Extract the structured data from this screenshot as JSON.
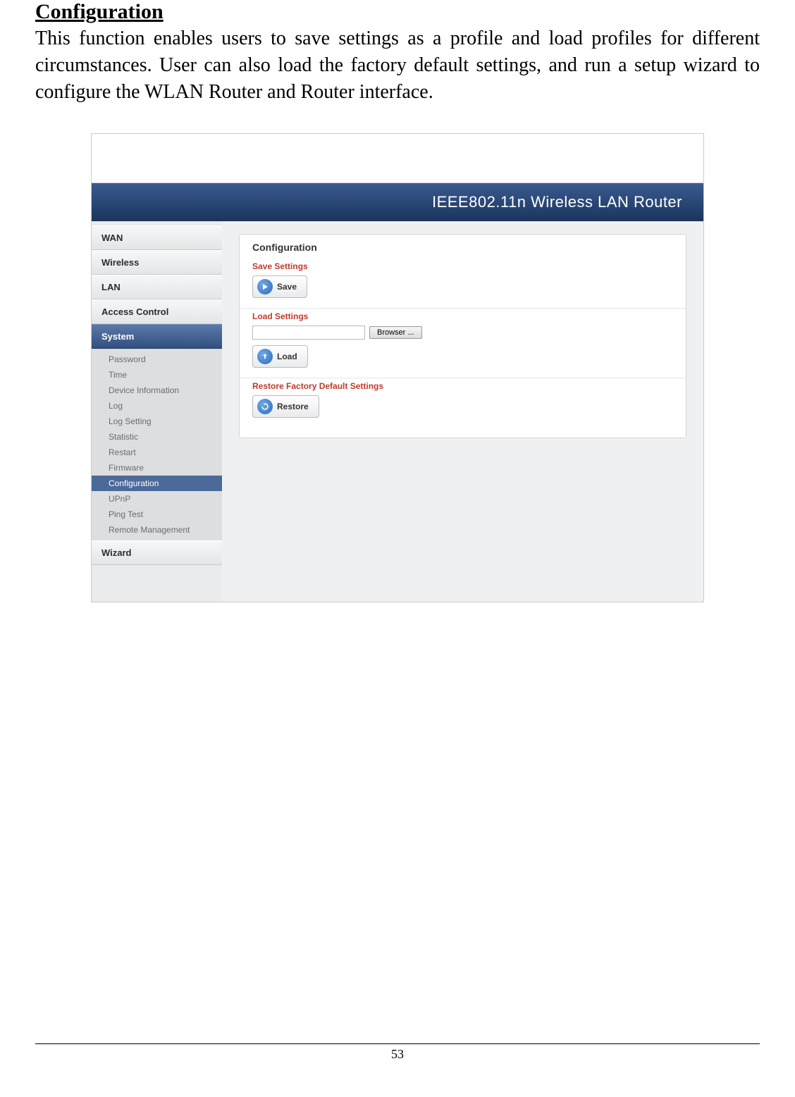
{
  "doc": {
    "heading": "Configuration",
    "description": "This function enables users to save settings as a profile and load profiles for different circumstances. User can also load the factory default settings, and run a setup wizard to configure the WLAN Router and Router interface.",
    "pageNumber": "53"
  },
  "router": {
    "bannerTitle": "IEEE802.11n  Wireless LAN Router",
    "nav": {
      "wan": "WAN",
      "wireless": "Wireless",
      "lan": "LAN",
      "accessControl": "Access Control",
      "system": "System",
      "wizard": "Wizard"
    },
    "systemSub": {
      "password": "Password",
      "time": "Time",
      "deviceInfo": "Device Information",
      "log": "Log",
      "logSetting": "Log Setting",
      "statistic": "Statistic",
      "restart": "Restart",
      "firmware": "Firmware",
      "configuration": "Configuration",
      "upnp": "UPnP",
      "pingTest": "Ping Test",
      "remoteMgmt": "Remote Management"
    },
    "panel": {
      "title": "Configuration",
      "saveSettingsLabel": "Save Settings",
      "saveBtn": "Save",
      "loadSettingsLabel": "Load Settings",
      "browserBtn": "Browser ...",
      "loadBtn": "Load",
      "restoreLabel": "Restore Factory Default Settings",
      "restoreBtn": "Restore"
    }
  }
}
